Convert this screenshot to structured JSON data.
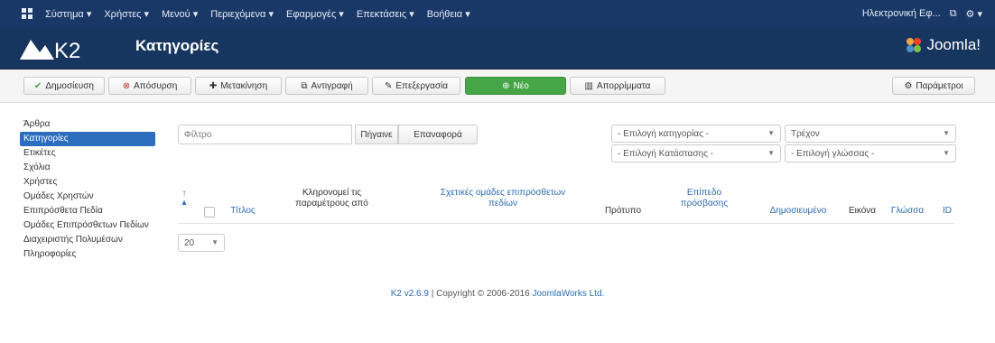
{
  "topbar": {
    "menu": [
      "Σύστημα ▾",
      "Χρήστες ▾",
      "Μενού ▾",
      "Περιεχόμενα ▾",
      "Εφαρμογές ▾",
      "Επεκτάσεις ▾",
      "Βοήθεια ▾"
    ],
    "user": "Ηλεκτρονική Εφ...",
    "settings": "⚙ ▾"
  },
  "header": {
    "title": "Κατηγορίες",
    "joomla": "Joomla!"
  },
  "toolbar": {
    "publish": "Δημοσίευση",
    "unpublish": "Απόσυρση",
    "move": "Μετακίνηση",
    "copy": "Αντιγραφή",
    "edit": "Επεξεργασία",
    "new": "Νέο",
    "trash": "Απορρίμματα",
    "options": "Παράμετροι"
  },
  "sidebar": {
    "items": [
      "Άρθρα",
      "Κατηγορίες",
      "Ετικέτες",
      "Σχόλια",
      "Χρήστες",
      "Ομάδες Χρηστών",
      "Επιπρόσθετα Πεδία",
      "Ομάδες Επιπρόσθετων Πεδίων",
      "Διαχειριστής Πολυμέσων",
      "Πληροφορίες"
    ]
  },
  "filter": {
    "placeholder": "Φίλτρο",
    "go": "Πήγαινε",
    "reset": "Επαναφορά",
    "category": "- Επιλογή κατηγορίας -",
    "status": "- Επιλογή Κατάστασης -",
    "current": "Τρέχον",
    "language": "- Επιλογή γλώσσας -"
  },
  "table": {
    "sort": "↑",
    "columns": {
      "title": "Τίτλος",
      "inherit_1": "Κληρονομεί τις",
      "inherit_2": "παραμέτρους από",
      "groups_1": "Σχετικές ομάδες επιπρόσθετων",
      "groups_2": "πεδίων",
      "template": "Πρότυπο",
      "access_1": "Επίπεδο",
      "access_2": "πρόσβασης",
      "published": "Δημοσιευμένο",
      "image": "Εικόνα",
      "language": "Γλώσσα",
      "id": "ID"
    },
    "limit": "20"
  },
  "footer": {
    "version": "K2 v2.6.9",
    "copyright": "Copyright © 2006-2016",
    "vendor": "JoomlaWorks Ltd."
  }
}
